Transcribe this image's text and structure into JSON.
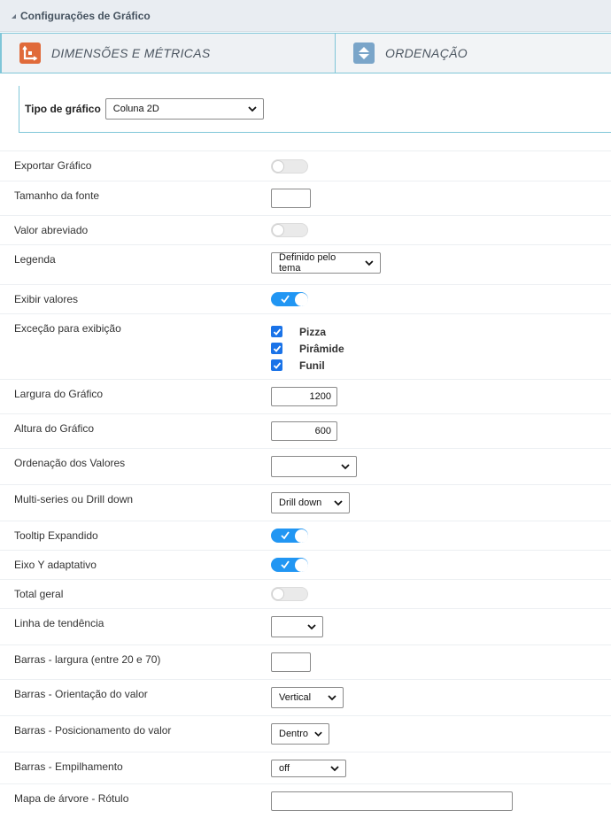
{
  "header": {
    "title": "Configurações de Gráfico"
  },
  "tabs": [
    {
      "label": "DIMENSÕES E MÉTRICAS",
      "icon": "chart-axis-icon"
    },
    {
      "label": "ORDENAÇÃO",
      "icon": "sort-icon"
    }
  ],
  "chart_type": {
    "label": "Tipo de gráfico",
    "value": "Coluna 2D"
  },
  "settings": {
    "export": {
      "label": "Exportar Gráfico",
      "on": false
    },
    "font_size": {
      "label": "Tamanho da fonte",
      "value": ""
    },
    "abbrev": {
      "label": "Valor abreviado",
      "on": false
    },
    "legend": {
      "label": "Legenda",
      "value": "Definido pelo tema"
    },
    "show_values": {
      "label": "Exibir valores",
      "on": true
    },
    "exception": {
      "label": "Exceção para exibição",
      "options": [
        {
          "label": "Pizza",
          "checked": true
        },
        {
          "label": "Pirâmide",
          "checked": true
        },
        {
          "label": "Funil",
          "checked": true
        }
      ]
    },
    "width": {
      "label": "Largura do Gráfico",
      "value": "1200"
    },
    "height": {
      "label": "Altura do Gráfico",
      "value": "600"
    },
    "value_order": {
      "label": "Ordenação dos Valores",
      "value": ""
    },
    "multiseries": {
      "label": "Multi-series ou Drill down",
      "value": "Drill down"
    },
    "tooltip": {
      "label": "Tooltip Expandido",
      "on": true
    },
    "y_axis": {
      "label": "Eixo Y adaptativo",
      "on": true
    },
    "total": {
      "label": "Total geral",
      "on": false
    },
    "trend": {
      "label": "Linha de tendência",
      "value": ""
    },
    "bar_width": {
      "label": "Barras - largura (entre 20 e 70)",
      "value": ""
    },
    "bar_orientation": {
      "label": "Barras - Orientação do valor",
      "value": "Vertical"
    },
    "bar_position": {
      "label": "Barras - Posicionamento do valor",
      "value": "Dentro"
    },
    "bar_stack": {
      "label": "Barras - Empilhamento",
      "value": "off"
    },
    "treemap_label": {
      "label": "Mapa de árvore - Rótulo",
      "value": ""
    }
  },
  "colors": {
    "accent": "#2196f3",
    "border": "#7fc6d8",
    "header_bg": "#e9edf2"
  }
}
